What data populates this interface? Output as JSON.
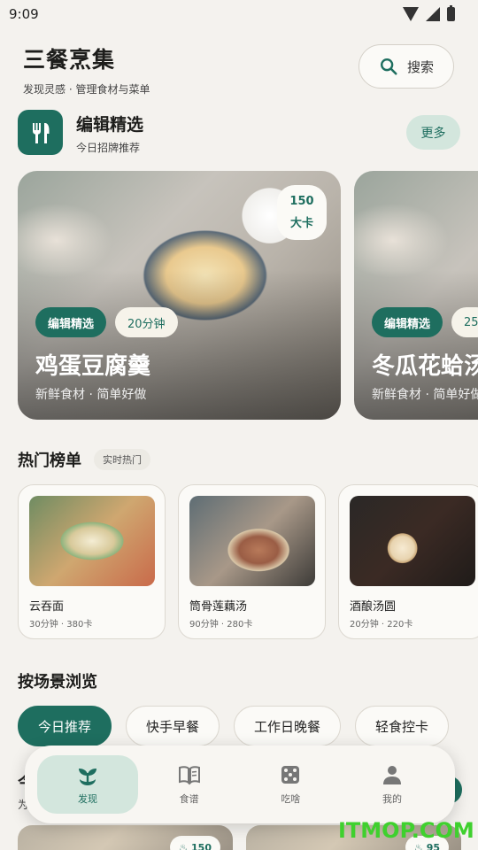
{
  "status": {
    "time": "9:09"
  },
  "header": {
    "title": "三餐烹集",
    "subtitle": "发现灵感 · 管理食材与菜单",
    "search_label": "搜索"
  },
  "editor": {
    "title": "编辑精选",
    "subtitle": "今日招牌推荐",
    "more_label": "更多"
  },
  "featured": [
    {
      "kcal": "150",
      "kcal_unit": "大卡",
      "tag": "编辑精选",
      "time": "20分钟",
      "title": "鸡蛋豆腐羹",
      "sub": "新鲜食材 · 简单好做"
    },
    {
      "kcal": "",
      "kcal_unit": "",
      "tag": "编辑精选",
      "time": "25",
      "title": "冬瓜花蛤汤",
      "sub": "新鲜食材 · 简单好做"
    }
  ],
  "hot": {
    "title": "热门榜单",
    "badge": "实时热门",
    "items": [
      {
        "name": "云吞面",
        "meta": "30分钟 · 380卡"
      },
      {
        "name": "筒骨莲藕汤",
        "meta": "90分钟 · 280卡"
      },
      {
        "name": "酒酿汤圆",
        "meta": "20分钟 · 220卡"
      }
    ]
  },
  "scenes": {
    "title": "按场景浏览",
    "chips": [
      "今日推荐",
      "快手早餐",
      "工作日晚餐",
      "轻食控卡"
    ]
  },
  "peek": {
    "title": "今",
    "sub": "为",
    "badge1": "150",
    "badge2": "95"
  },
  "nav": {
    "items": [
      {
        "label": "发现"
      },
      {
        "label": "食谱"
      },
      {
        "label": "吃啥"
      },
      {
        "label": "我的"
      }
    ]
  },
  "watermark": "ITMOP.COM",
  "colors": {
    "accent": "#1e6e5f",
    "accent_light": "#d3e6dd",
    "background": "#f4f2ee"
  },
  "icons": [
    "search-icon",
    "fork-knife-icon",
    "sprout-icon",
    "book-icon",
    "dice-icon",
    "person-icon",
    "flame-icon"
  ]
}
